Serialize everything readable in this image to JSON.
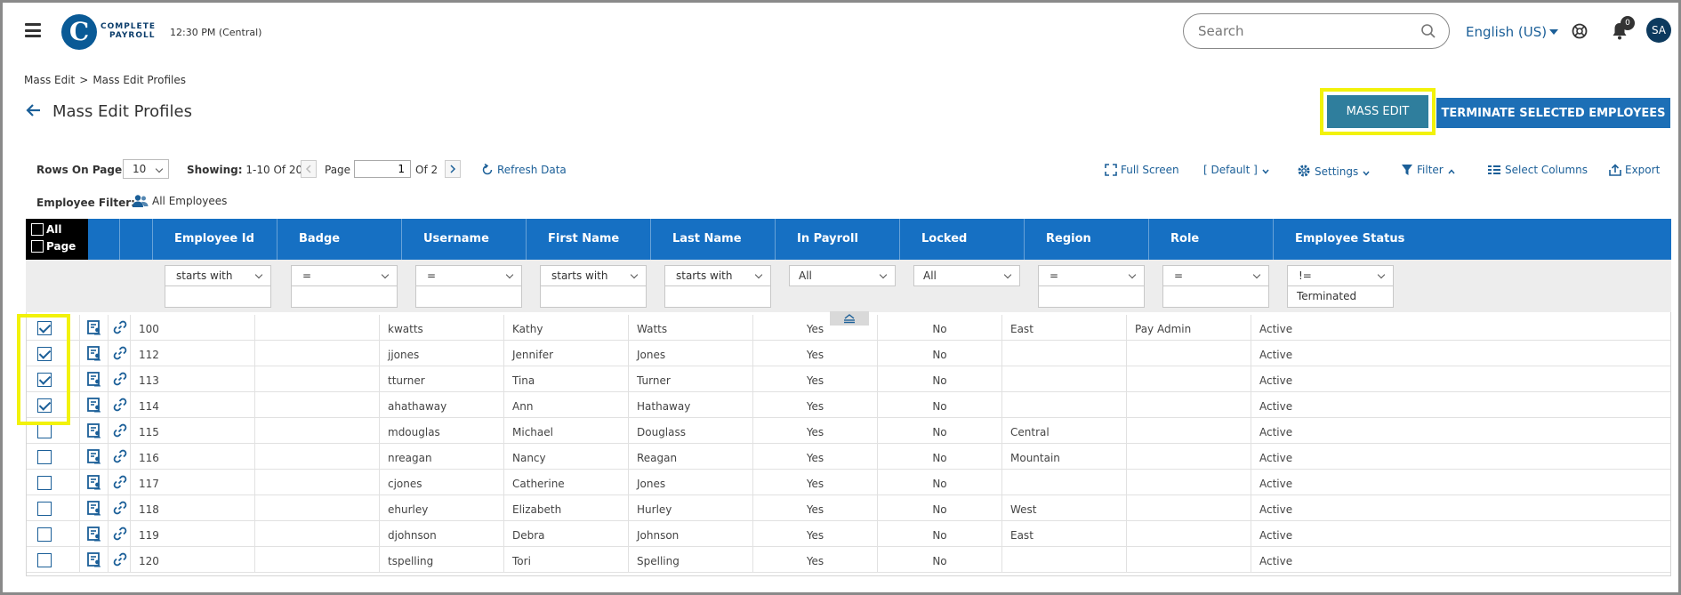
{
  "header": {
    "logo_letter": "C",
    "logo_line1": "COMPLETE",
    "logo_line2": "PAYROLL",
    "time": "12:30 PM (Central)",
    "search_placeholder": "Search",
    "language": "English (US)",
    "notification_count": "0",
    "avatar_initials": "SA"
  },
  "breadcrumb": {
    "root": "Mass Edit",
    "separator": ">",
    "current": "Mass Edit Profiles"
  },
  "page_title": "Mass Edit Profiles",
  "actions": {
    "mass_edit": "MASS EDIT",
    "terminate": "TERMINATE SELECTED EMPLOYEES"
  },
  "toolbar": {
    "rows_label": "Rows On Page",
    "rows_value": "10",
    "showing_label": "Showing:",
    "showing_value": "1-10 Of 20",
    "page_label": "Page",
    "page_value": "1",
    "page_of": "Of 2",
    "refresh": "Refresh Data",
    "full_screen": "Full Screen",
    "view": "[ Default ]",
    "settings": "Settings",
    "filter": "Filter",
    "select_columns": "Select Columns",
    "export": "Export"
  },
  "employee_filter": {
    "label": "Employee Filter:",
    "value": "All Employees"
  },
  "table": {
    "select_all_label": "All",
    "select_page_label": "Page",
    "columns": [
      "Employee Id",
      "Badge",
      "Username",
      "First Name",
      "Last Name",
      "In Payroll",
      "Locked",
      "Region",
      "Role",
      "Employee Status"
    ],
    "filters": {
      "employee_id": "starts with",
      "badge": "=",
      "username": "=",
      "first_name": "starts with",
      "last_name": "starts with",
      "in_payroll": "All",
      "locked": "All",
      "region": "=",
      "role": "=",
      "status_op": "!=",
      "status_value": "Terminated"
    },
    "rows": [
      {
        "checked": true,
        "id": "100",
        "badge": "",
        "username": "kwatts",
        "first": "Kathy",
        "last": "Watts",
        "payroll": "Yes",
        "locked": "No",
        "region": "East",
        "role": "Pay Admin",
        "status": "Active"
      },
      {
        "checked": true,
        "id": "112",
        "badge": "",
        "username": "jjones",
        "first": "Jennifer",
        "last": "Jones",
        "payroll": "Yes",
        "locked": "No",
        "region": "",
        "role": "",
        "status": "Active"
      },
      {
        "checked": true,
        "id": "113",
        "badge": "",
        "username": "tturner",
        "first": "Tina",
        "last": "Turner",
        "payroll": "Yes",
        "locked": "No",
        "region": "",
        "role": "",
        "status": "Active"
      },
      {
        "checked": true,
        "id": "114",
        "badge": "",
        "username": "ahathaway",
        "first": "Ann",
        "last": "Hathaway",
        "payroll": "Yes",
        "locked": "No",
        "region": "",
        "role": "",
        "status": "Active"
      },
      {
        "checked": false,
        "id": "115",
        "badge": "",
        "username": "mdouglas",
        "first": "Michael",
        "last": "Douglass",
        "payroll": "Yes",
        "locked": "No",
        "region": "Central",
        "role": "",
        "status": "Active"
      },
      {
        "checked": false,
        "id": "116",
        "badge": "",
        "username": "nreagan",
        "first": "Nancy",
        "last": "Reagan",
        "payroll": "Yes",
        "locked": "No",
        "region": "Mountain",
        "role": "",
        "status": "Active"
      },
      {
        "checked": false,
        "id": "117",
        "badge": "",
        "username": "cjones",
        "first": "Catherine",
        "last": "Jones",
        "payroll": "Yes",
        "locked": "No",
        "region": "",
        "role": "",
        "status": "Active"
      },
      {
        "checked": false,
        "id": "118",
        "badge": "",
        "username": "ehurley",
        "first": "Elizabeth",
        "last": "Hurley",
        "payroll": "Yes",
        "locked": "No",
        "region": "West",
        "role": "",
        "status": "Active"
      },
      {
        "checked": false,
        "id": "119",
        "badge": "",
        "username": "djohnson",
        "first": "Debra",
        "last": "Johnson",
        "payroll": "Yes",
        "locked": "No",
        "region": "East",
        "role": "",
        "status": "Active"
      },
      {
        "checked": false,
        "id": "120",
        "badge": "",
        "username": "tspelling",
        "first": "Tori",
        "last": "Spelling",
        "payroll": "Yes",
        "locked": "No",
        "region": "",
        "role": "",
        "status": "Active"
      }
    ]
  },
  "colors": {
    "brand": "#0a5a96",
    "header_blue": "#1670c3",
    "highlight": "#f2f20a",
    "mass_edit": "#2f7e9d",
    "terminate": "#1d6fb6"
  },
  "icons": [
    "menu-icon",
    "search-icon",
    "help-icon",
    "bell-icon",
    "back-arrow-icon",
    "refresh-icon",
    "fullscreen-icon",
    "settings-icon",
    "filter-icon",
    "columns-icon",
    "export-icon",
    "users-icon",
    "profile-card-icon",
    "link-icon"
  ]
}
